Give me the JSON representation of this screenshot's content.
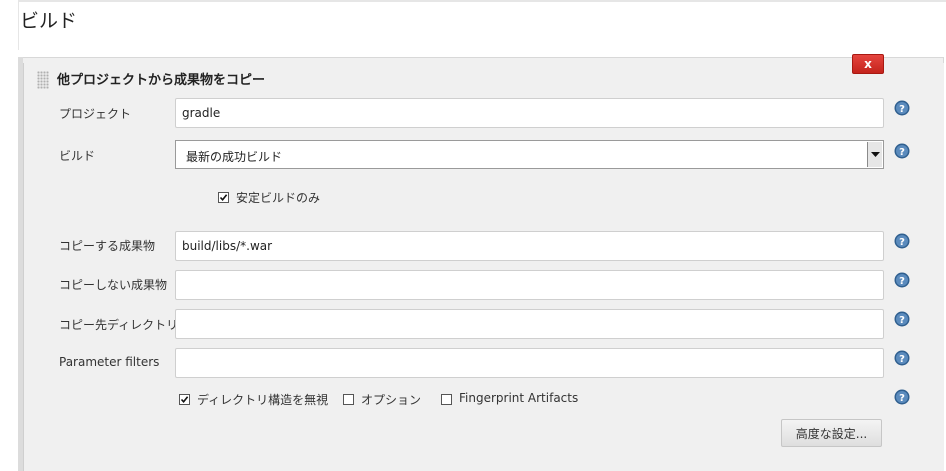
{
  "section": {
    "title": "ビルド"
  },
  "step": {
    "title": "他プロジェクトから成果物をコピー",
    "delete_label": "x"
  },
  "fields": {
    "project": {
      "label": "プロジェクト",
      "value": "gradle"
    },
    "build": {
      "label": "ビルド",
      "selected": "最新の成功ビルド",
      "stable_only_label": "安定ビルドのみ",
      "stable_only_checked": true
    },
    "artifacts_to_copy": {
      "label": "コピーする成果物",
      "value": "build/libs/*.war"
    },
    "artifacts_not_to_copy": {
      "label": "コピーしない成果物",
      "value": ""
    },
    "target_directory": {
      "label": "コピー先ディレクトリ",
      "value": ""
    },
    "parameter_filters": {
      "label": "Parameter filters",
      "value": ""
    }
  },
  "options": {
    "flatten": {
      "label": "ディレクトリ構造を無視",
      "checked": true
    },
    "optional": {
      "label": "オプション",
      "checked": false
    },
    "fingerprint": {
      "label": "Fingerprint Artifacts",
      "checked": false
    }
  },
  "advanced_button": "高度な設定...",
  "colors": {
    "delete": "#d03a33",
    "help": "#2f5f8f",
    "panel": "#f0f0f0"
  },
  "icons": {
    "help": "help-icon",
    "grip": "drag-handle-icon",
    "arrow": "chevron-down-icon"
  }
}
